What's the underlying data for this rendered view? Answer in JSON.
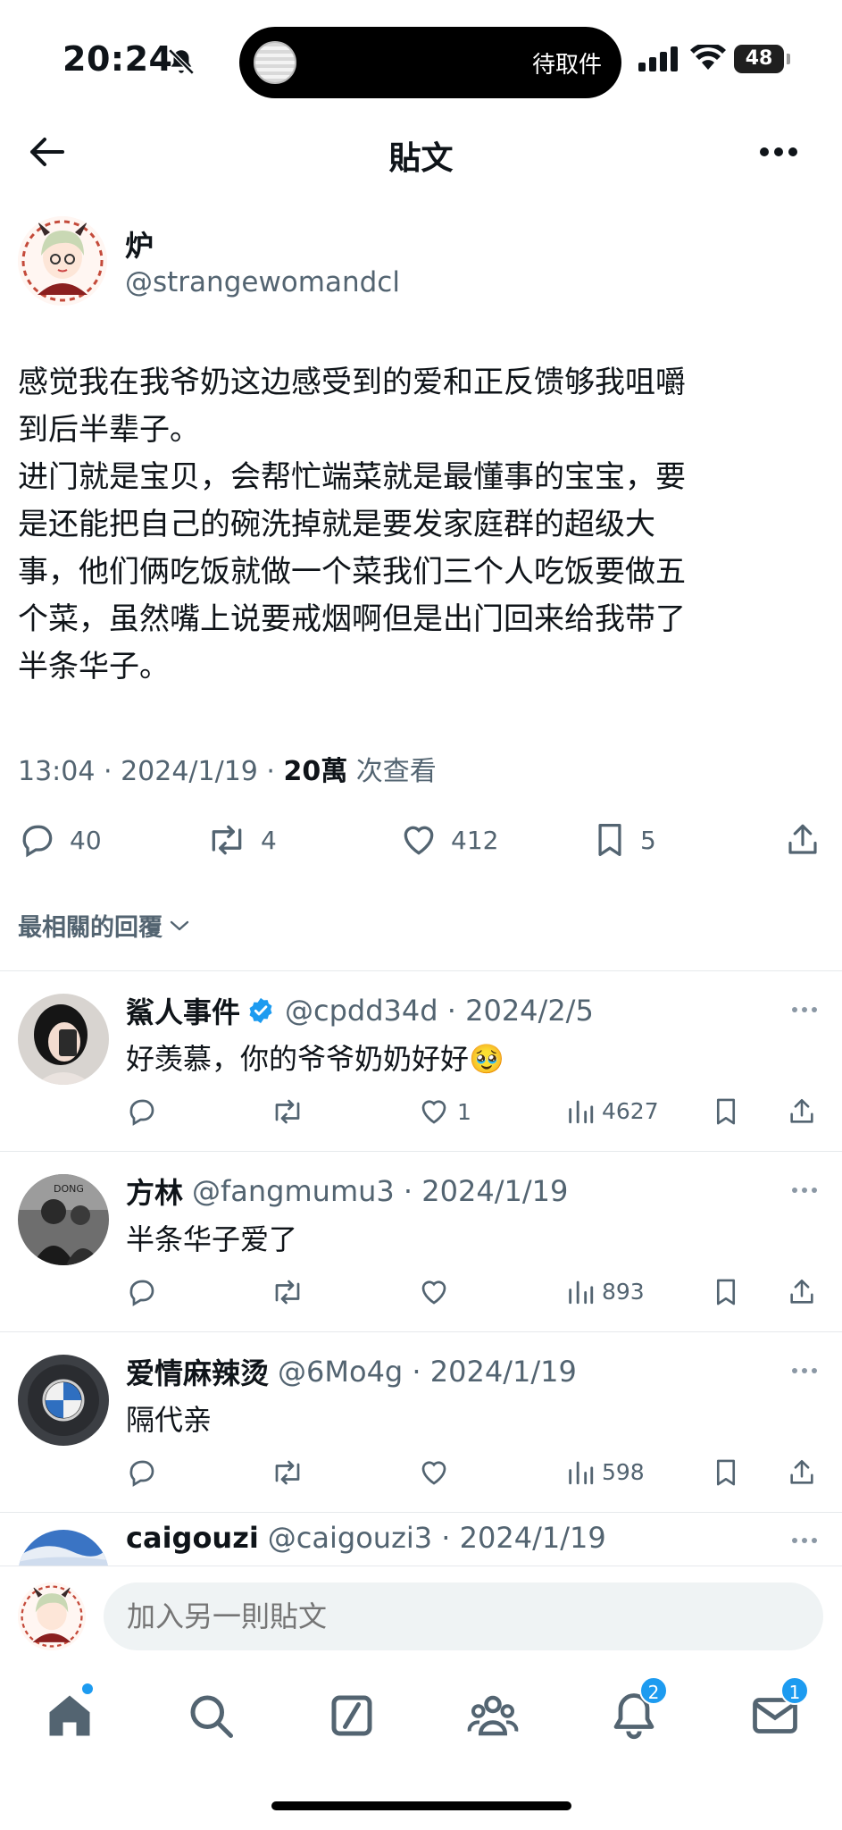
{
  "status_bar": {
    "time": "20:24",
    "live_activity": "待取件",
    "battery": "48"
  },
  "header": {
    "title": "貼文"
  },
  "post": {
    "author": {
      "name": "炉",
      "handle": "@strangewomandcl"
    },
    "text": "感觉我在我爷奶这边感受到的爱和正反馈够我咀嚼\n到后半辈子。\n进门就是宝贝，会帮忙端菜就是最懂事的宝宝，要\n是还能把自己的碗洗掉就是要发家庭群的超级大\n事，他们俩吃饭就做一个菜我们三个人吃饭要做五\n个菜，虽然嘴上说要戒烟啊但是出门回来给我带了\n半条华子。",
    "time": "13:04 · 2024/1/19 · ",
    "views_count": "20萬",
    "views_label": " 次查看",
    "stats": {
      "replies": "40",
      "reposts": "4",
      "likes": "412",
      "bookmarks": "5"
    }
  },
  "relevant_replies_label": "最相關的回覆",
  "replies": [
    {
      "name": "鯊人事件",
      "verified": true,
      "handle": "@cpdd34d · 2024/2/5",
      "text": "好羡慕，你的爷爷奶奶好好🥹",
      "likes": "1",
      "views": "4627"
    },
    {
      "name": "方林",
      "verified": false,
      "handle": "@fangmumu3 · 2024/1/19",
      "text": "半条华子爱了",
      "likes": "",
      "views": "893"
    },
    {
      "name": "爱情麻辣烫",
      "verified": false,
      "handle": "@6Mo4g · 2024/1/19",
      "text": "隔代亲",
      "likes": "",
      "views": "598"
    },
    {
      "name": "caigouzi",
      "verified": false,
      "handle": "@caigouzi3 · 2024/1/19",
      "text": "",
      "likes": "",
      "views": ""
    }
  ],
  "compose": {
    "placeholder": "加入另一則貼文"
  },
  "tabbar": {
    "notifications_badge": "2",
    "messages_badge": "1"
  },
  "colors": {
    "accent": "#1d9bf0",
    "text": "#0f1419",
    "secondary": "#536471"
  }
}
